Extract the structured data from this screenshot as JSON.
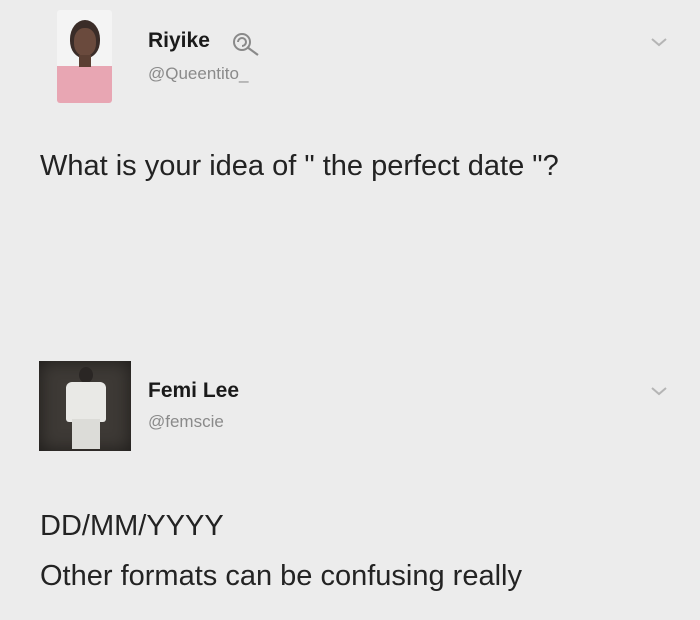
{
  "tweets": [
    {
      "display_name": "Riyike",
      "handle": "@Queentito_",
      "badge_icon": "lollipop-icon",
      "menu_icon": "chevron-down-icon",
      "text": "What is your idea of \" the perfect date \"?"
    },
    {
      "display_name": "Femi Lee",
      "handle": "@femscie",
      "menu_icon": "chevron-down-icon",
      "text_lines": [
        "DD/MM/YYYY",
        "Other formats can be confusing really"
      ]
    }
  ]
}
